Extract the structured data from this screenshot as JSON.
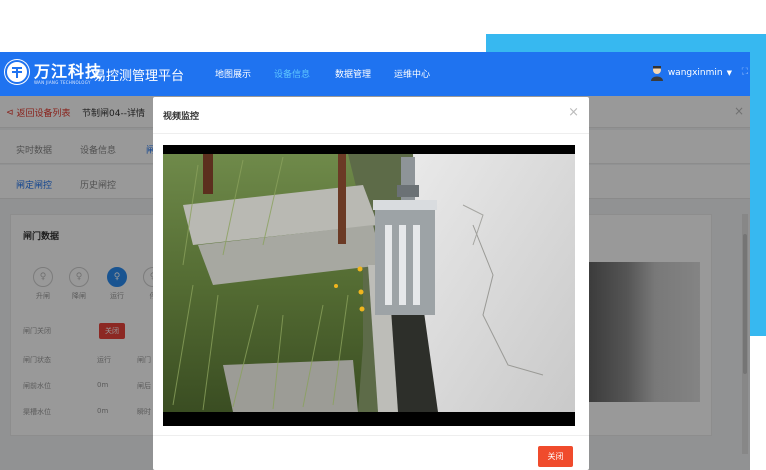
{
  "header": {
    "brand": "万江科技",
    "brand_sub": "WAN JIANG TECHNOLOGY",
    "product": "易控测管理平台",
    "nav": [
      {
        "label": "地图展示",
        "active": false
      },
      {
        "label": "设备信息",
        "active": true
      },
      {
        "label": "数据管理",
        "active": false
      },
      {
        "label": "运维中心",
        "active": false
      }
    ],
    "user": "wangxinmin"
  },
  "breadcrumb": {
    "back_label": "返回设备列表",
    "current": "节制闸04--详情"
  },
  "tabs_primary": [
    "实时数据",
    "设备信息",
    "闸"
  ],
  "tabs_secondary": [
    "闸定闸控",
    "历史闸控"
  ],
  "gate_panel": {
    "title": "闸门数据",
    "controls": [
      {
        "label": "升闸",
        "active": false
      },
      {
        "label": "降闸",
        "active": false
      },
      {
        "label": "运行",
        "active": true
      },
      {
        "label": "停",
        "active": false
      }
    ],
    "rows": [
      {
        "label": "闸门状态",
        "value": "",
        "badge": "关闭"
      },
      {
        "label": "闸门状态",
        "value": "运行",
        "extra": "闸门"
      },
      {
        "label": "闸前水位",
        "value": "0m",
        "extra": "闸后"
      },
      {
        "label": "渠槽水位",
        "value": "0m",
        "extra": "瞬时"
      }
    ],
    "row1_label": "闸门关闭"
  },
  "modal": {
    "title": "视频监控",
    "close_button": "关闭"
  }
}
